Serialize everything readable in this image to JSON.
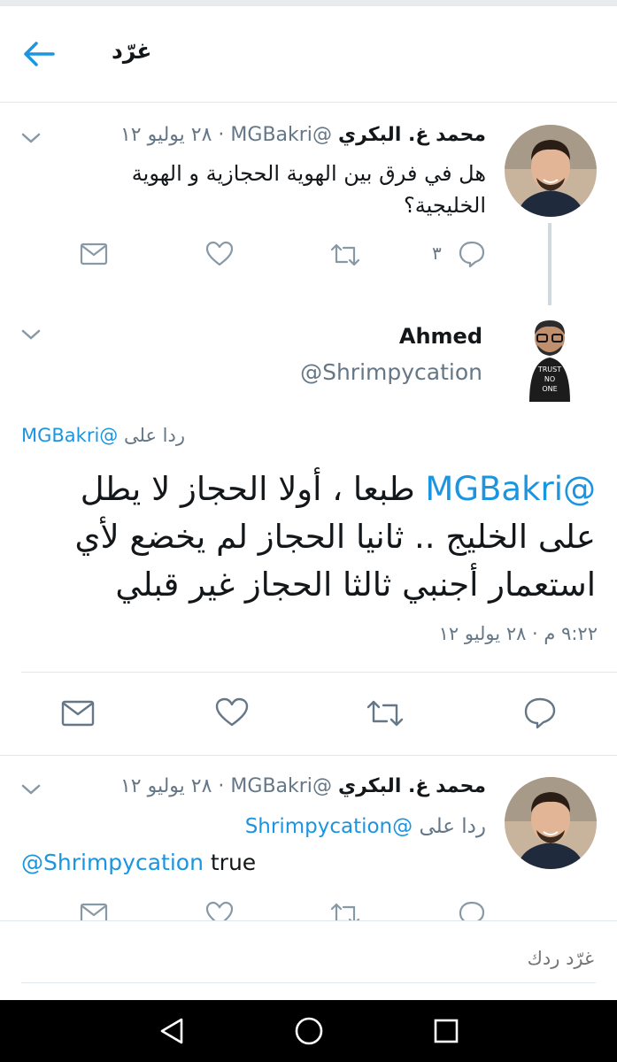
{
  "header": {
    "title": "غرّد"
  },
  "tweets": [
    {
      "name": "محمد غ. البكري",
      "handle": "@MGBakri",
      "date": "٢٨ يوليو ١٢",
      "separator": "·",
      "text": "هل في فرق بين الهوية الحجازية و الهوية الخليجية؟",
      "reply_count": "٣"
    },
    {
      "name": "Ahmed",
      "handle": "@Shrimpycation",
      "avatar_text": [
        "TRUST",
        "NO",
        "ONE"
      ],
      "reply_to_label": "ردا على",
      "reply_to_handle": "@MGBakri",
      "mention": "@MGBakri",
      "text": "طبعا ، أولا الحجاز لا يطل على الخليج .. ثانيا الحجاز لم يخضع لأي استعمار أجنبي ثالثا الحجاز غير قبلي",
      "timestamp": "٩:٢٢ م · ٢٨ يوليو ١٢"
    },
    {
      "name": "محمد غ. البكري",
      "handle": "@MGBakri",
      "date": "٢٨ يوليو ١٢",
      "separator": "·",
      "reply_to_label": "ردا على",
      "reply_to_handle": "@Shrimpycation",
      "mention": "@Shrimpycation",
      "text": "true"
    }
  ],
  "compose": {
    "placeholder": "غرّد ردك"
  },
  "colors": {
    "accent": "#1b95e0",
    "muted": "#657786",
    "text": "#14171a",
    "divider": "#e1e8ed"
  },
  "icons": [
    "back-arrow-icon",
    "chevron-down-icon",
    "direct-message-icon",
    "like-icon",
    "retweet-icon",
    "reply-icon",
    "nav-back-icon",
    "nav-home-icon",
    "nav-recents-icon"
  ]
}
